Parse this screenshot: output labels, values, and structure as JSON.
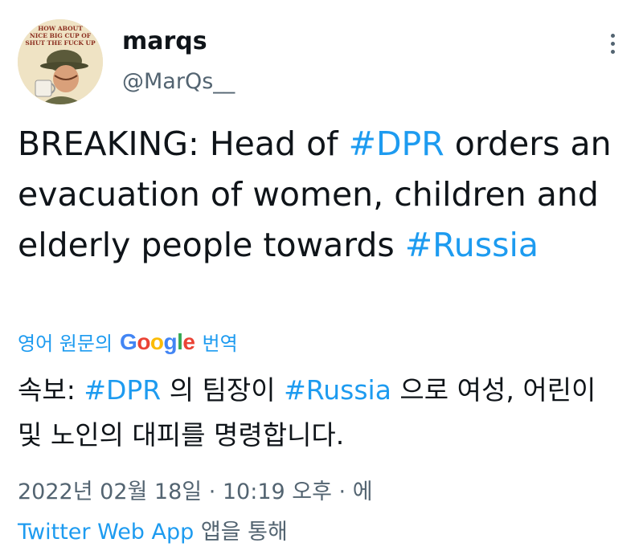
{
  "author": {
    "name": "marqs",
    "handle": "@MarQs__",
    "avatar_text_lines": [
      "HOW ABOUT",
      "NICE BIG CUP OF",
      "SHUT THE FUCK UP"
    ]
  },
  "tweet": {
    "part1": "BREAKING: Head of ",
    "hashtag1": "#DPR",
    "part2": " orders an evacuation of women, children and elderly people towards ",
    "hashtag2": "#Russia"
  },
  "translate": {
    "prefix": "영어 원문의",
    "suffix": "번역",
    "google": [
      "G",
      "o",
      "o",
      "g",
      "l",
      "e"
    ]
  },
  "translation": {
    "part1": "속보: ",
    "hashtag1": "#DPR",
    "part2": " 의 팀장이 ",
    "hashtag2": "#Russia",
    "part3": " 으로 여성, 어린이 및 노인의 대피를 명령합니다."
  },
  "meta": {
    "date": "2022년 02월 18일",
    "sep": " · ",
    "time": "10:19 오후",
    "sep2": " · ",
    "suffix": "에"
  },
  "source": {
    "app": "Twitter Web App",
    "suffix": " 앱을 통해"
  },
  "colors": {
    "link": "#1d9bf0",
    "secondary_text": "#536471",
    "primary_text": "#0f1419"
  }
}
